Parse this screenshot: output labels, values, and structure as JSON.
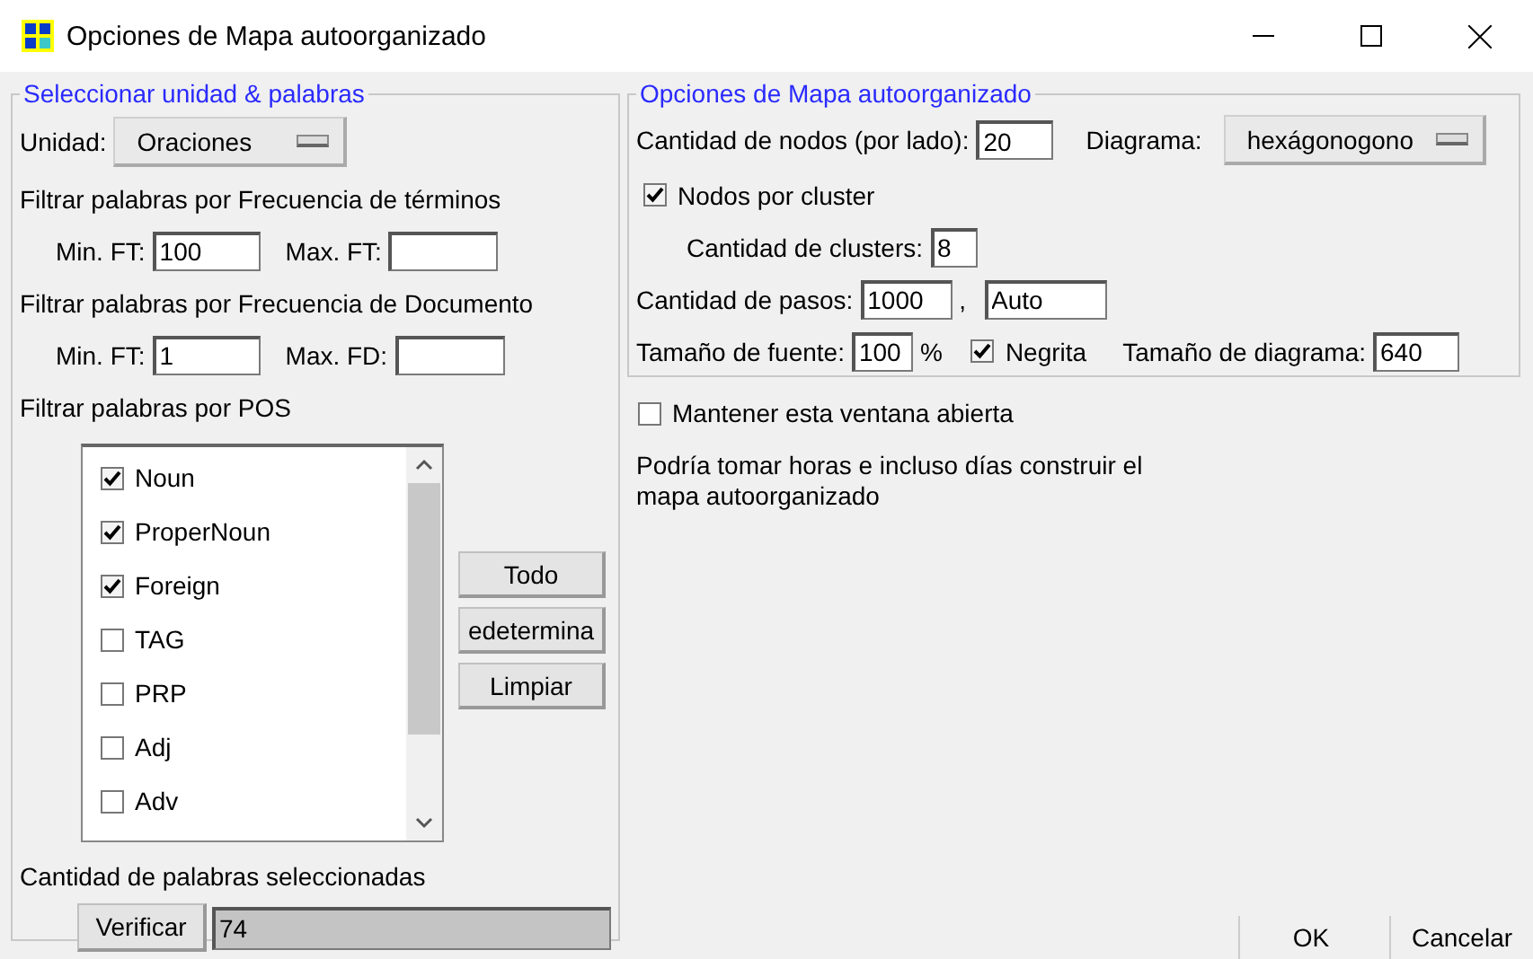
{
  "window": {
    "title": "Opciones de Mapa autoorganizado"
  },
  "left_group": {
    "title": "Seleccionar unidad & palabras",
    "unit_label": "Unidad:",
    "unit_value": "Oraciones",
    "tf": {
      "label": "Filtrar palabras por Frecuencia de términos",
      "min_label": "Min. FT:",
      "min_value": "100",
      "max_label": "Max. FT:"
    },
    "df": {
      "label": "Filtrar palabras por Frecuencia de Documento",
      "min_label": "Min. FT:",
      "min_value": "1",
      "max_label": "Max. FD:"
    },
    "pos_label": "Filtrar palabras por POS",
    "pos_items": [
      {
        "label": "Noun",
        "checked": true
      },
      {
        "label": "ProperNoun",
        "checked": true
      },
      {
        "label": "Foreign",
        "checked": true
      },
      {
        "label": "TAG",
        "checked": false
      },
      {
        "label": "PRP",
        "checked": false
      },
      {
        "label": "Adj",
        "checked": false
      },
      {
        "label": "Adv",
        "checked": false
      }
    ],
    "pos_buttons": [
      "Todo",
      "edetermina",
      "Limpiar"
    ],
    "count_label": "Cantidad de palabras seleccionadas",
    "verify_button": "Verificar",
    "count_value": "74"
  },
  "right_group": {
    "title": "Opciones de Mapa autoorganizado",
    "nodes_label": "Cantidad de nodos (por lado):",
    "nodes_value": "20",
    "diagram_label": "Diagrama:",
    "diagram_value": "hexágonogono",
    "cluster_check": {
      "label": "Nodos por cluster",
      "checked": true
    },
    "clusters_label": "Cantidad de clusters:",
    "clusters_value": "8",
    "steps_label": "Cantidad de pasos:",
    "steps_value": "1000",
    "steps_sep": ",",
    "steps_value_2": "Auto",
    "font_label": "Tamaño de fuente:",
    "font_value": "100",
    "font_unit": "%",
    "bold_check": {
      "label": "Negrita",
      "checked": true
    },
    "diagram_size_label": "Tamaño de diagrama:",
    "diagram_size_value": "640"
  },
  "keep_open": {
    "label": "Mantener esta ventana abierta",
    "checked": false
  },
  "note": "Podría tomar horas e incluso días construir el mapa autoorganizado",
  "buttons": [
    "OK",
    "Cancelar"
  ]
}
